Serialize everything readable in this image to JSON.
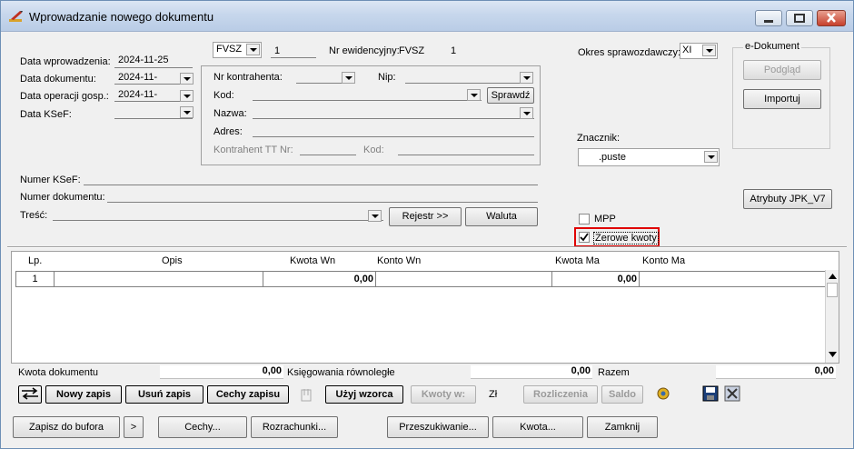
{
  "window": {
    "title": "Wprowadzanie nowego dokumentu"
  },
  "dates": {
    "data_wprowadzenia_label": "Data wprowadzenia:",
    "data_wprowadzenia_value": "2024-11-25",
    "data_dokumentu_label": "Data dokumentu:",
    "data_dokumentu_value": "2024-11-",
    "data_operacji_label": "Data operacji gosp.:",
    "data_operacji_value": "2024-11-",
    "data_ksef_label": "Data KSeF:",
    "data_ksef_value": ""
  },
  "doc_type": {
    "type": "FVSZ",
    "number": "1",
    "nr_ewidencyjny_label": "Nr ewidencyjny:",
    "nr_ewidencyjny_prefix": "FVSZ",
    "nr_ewidencyjny_number": "1"
  },
  "kontrahent": {
    "nr_label": "Nr kontrahenta:",
    "nip_label": "Nip:",
    "kod_label": "Kod:",
    "sprawdz_label": "Sprawdź",
    "nazwa_label": "Nazwa:",
    "adres_label": "Adres:",
    "tt_nr_label": "Kontrahent TT Nr:",
    "tt_kod_label": "Kod:"
  },
  "okres": {
    "label": "Okres sprawozdawczy:",
    "value": "XI"
  },
  "edokument": {
    "title": "e-Dokument",
    "podglad_label": "Podgląd",
    "importuj_label": "Importuj"
  },
  "znacznik": {
    "label": "Znacznik:",
    "value": ".puste"
  },
  "atrybuty_label": "Atrybuty JPK_V7",
  "fields": {
    "numer_ksef_label": "Numer KSeF:",
    "numer_dokumentu_label": "Numer dokumentu:",
    "tresc_label": "Treść:",
    "rejestr_label": "Rejestr >>",
    "waluta_label": "Waluta"
  },
  "checks": {
    "mpp_label": "MPP",
    "mpp_checked": false,
    "zerowe_label": "Zerowe kwoty",
    "zerowe_checked": true
  },
  "table": {
    "headers": [
      "Lp.",
      "Opis",
      "Kwota Wn",
      "Konto Wn",
      "Kwota Ma",
      "Konto Ma"
    ],
    "rows": [
      {
        "lp": "1",
        "opis": "",
        "kwota_wn": "0,00",
        "konto_wn": "",
        "kwota_ma": "0,00",
        "konto_ma": ""
      }
    ]
  },
  "summary": {
    "kwota_dokumentu_label": "Kwota dokumentu",
    "kwota_dokumentu_value": "0,00",
    "ksiegowania_label": "Księgowania równoległe",
    "ksiegowania_value": "0,00",
    "razem_label": "Razem",
    "razem_value": "0,00"
  },
  "toolbar": {
    "nowy_zapis": "Nowy zapis",
    "usun_zapis": "Usuń zapis",
    "cechy_zapisu": "Cechy zapisu",
    "uzyj_wzorca": "Użyj wzorca",
    "kwoty_w": "Kwoty w:",
    "currency": "Zł",
    "rozliczenia": "Rozliczenia",
    "saldo": "Saldo"
  },
  "bottom": {
    "zapisz": "Zapisz do bufora",
    "more": ">",
    "cechy": "Cechy...",
    "rozrachunki": "Rozrachunki...",
    "przeszukiwanie": "Przeszukiwanie...",
    "kwota": "Kwota...",
    "zamknij": "Zamknij"
  }
}
